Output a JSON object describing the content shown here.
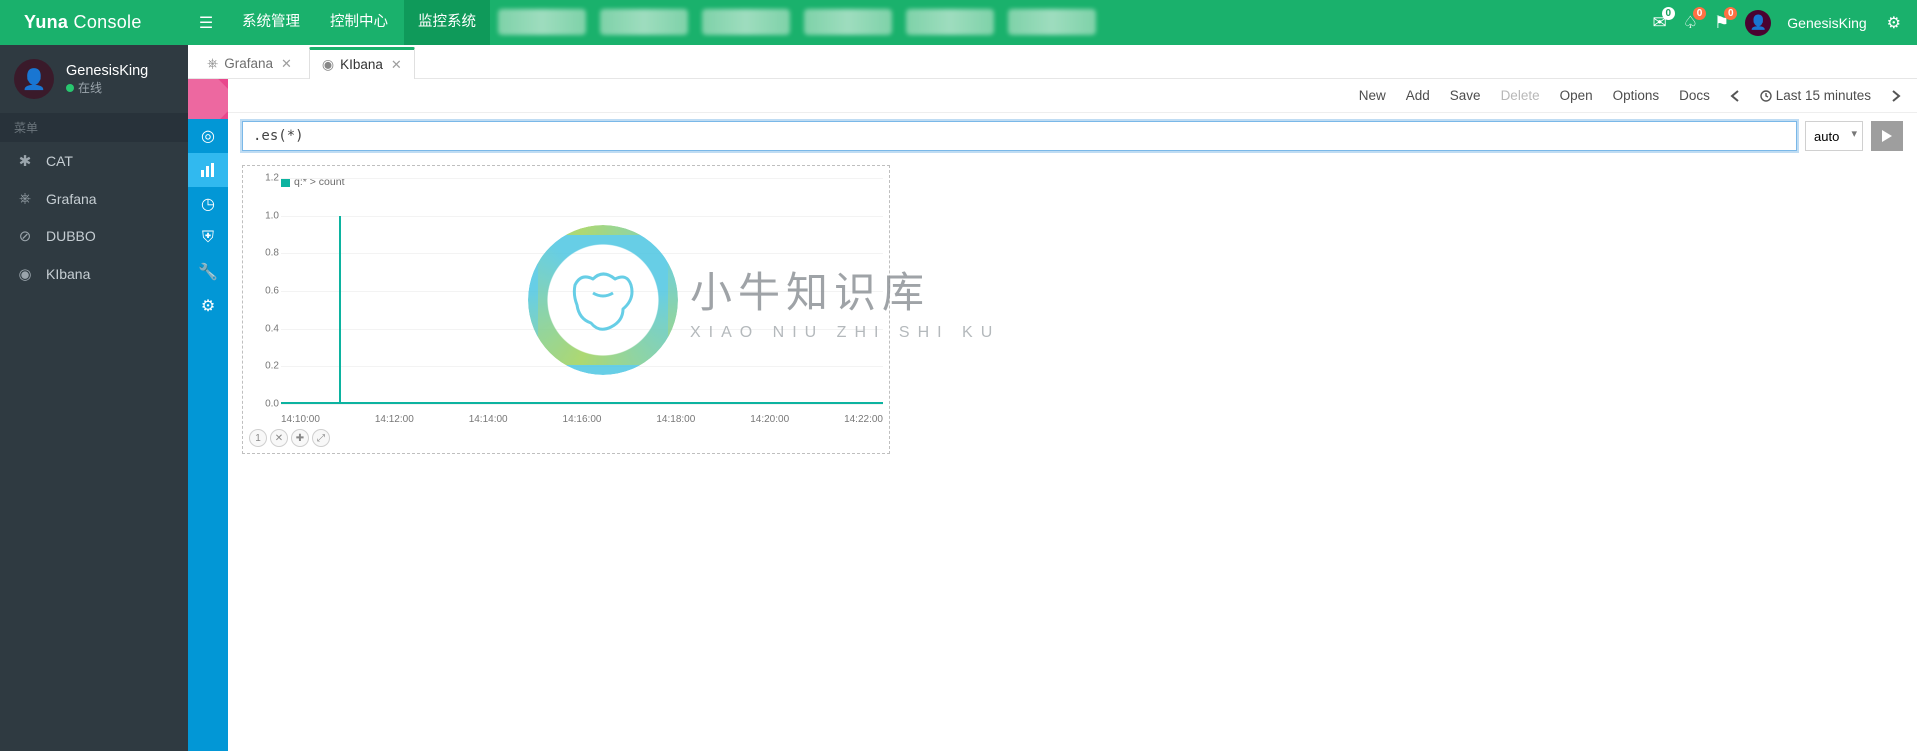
{
  "header": {
    "brand_strong": "Yuna",
    "brand_light": "Console",
    "nav": [
      "系统管理",
      "控制中心",
      "监控系统"
    ],
    "active_nav_index": 2,
    "right": {
      "mail_badge": "0",
      "bell_badge": "0",
      "flag_badge": "0",
      "username": "GenesisKing"
    }
  },
  "sidebar": {
    "user": {
      "name": "GenesisKing",
      "status": "在线"
    },
    "menu_header": "菜单",
    "items": [
      {
        "icon": "✱",
        "label": "CAT"
      },
      {
        "icon": "⎈",
        "label": "Grafana"
      },
      {
        "icon": "⊘",
        "label": "DUBBO"
      },
      {
        "icon": "◉",
        "label": "KIbana"
      }
    ]
  },
  "tabs": [
    {
      "icon": "⎈",
      "label": "Grafana",
      "active": false
    },
    {
      "icon": "◉",
      "label": "KIbana",
      "active": true
    }
  ],
  "kibana": {
    "rail": [
      "compass",
      "bar",
      "clock",
      "shield",
      "wrench",
      "gear"
    ],
    "actions": {
      "new": "New",
      "add": "Add",
      "save": "Save",
      "delete": "Delete",
      "open": "Open",
      "options": "Options",
      "docs": "Docs",
      "timerange": "Last 15 minutes"
    },
    "query": ".es(*)",
    "interval": "auto",
    "chart_legend": "q:* > count",
    "chart_controls": [
      "1",
      "✕",
      "✚",
      "⤢"
    ]
  },
  "watermark": {
    "big": "小牛知识库",
    "small": "XIAO NIU ZHI SHI KU"
  },
  "chart_data": {
    "type": "line",
    "title": "",
    "xlabel": "",
    "ylabel": "",
    "ylim": [
      0,
      1.2
    ],
    "yticks": [
      0.0,
      0.2,
      0.4,
      0.6,
      0.8,
      1.0,
      1.2
    ],
    "xticks": [
      "14:10:00",
      "14:12:00",
      "14:14:00",
      "14:16:00",
      "14:18:00",
      "14:20:00",
      "14:22:00"
    ],
    "series": [
      {
        "name": "q:* > count",
        "color": "#0cb3a0",
        "x": [
          "14:10:00",
          "14:11:00",
          "14:11:10",
          "14:12:00",
          "14:14:00",
          "14:16:00",
          "14:18:00",
          "14:20:00",
          "14:22:00"
        ],
        "y": [
          0,
          0,
          1.0,
          0,
          0,
          0,
          0,
          0,
          0
        ]
      }
    ]
  }
}
